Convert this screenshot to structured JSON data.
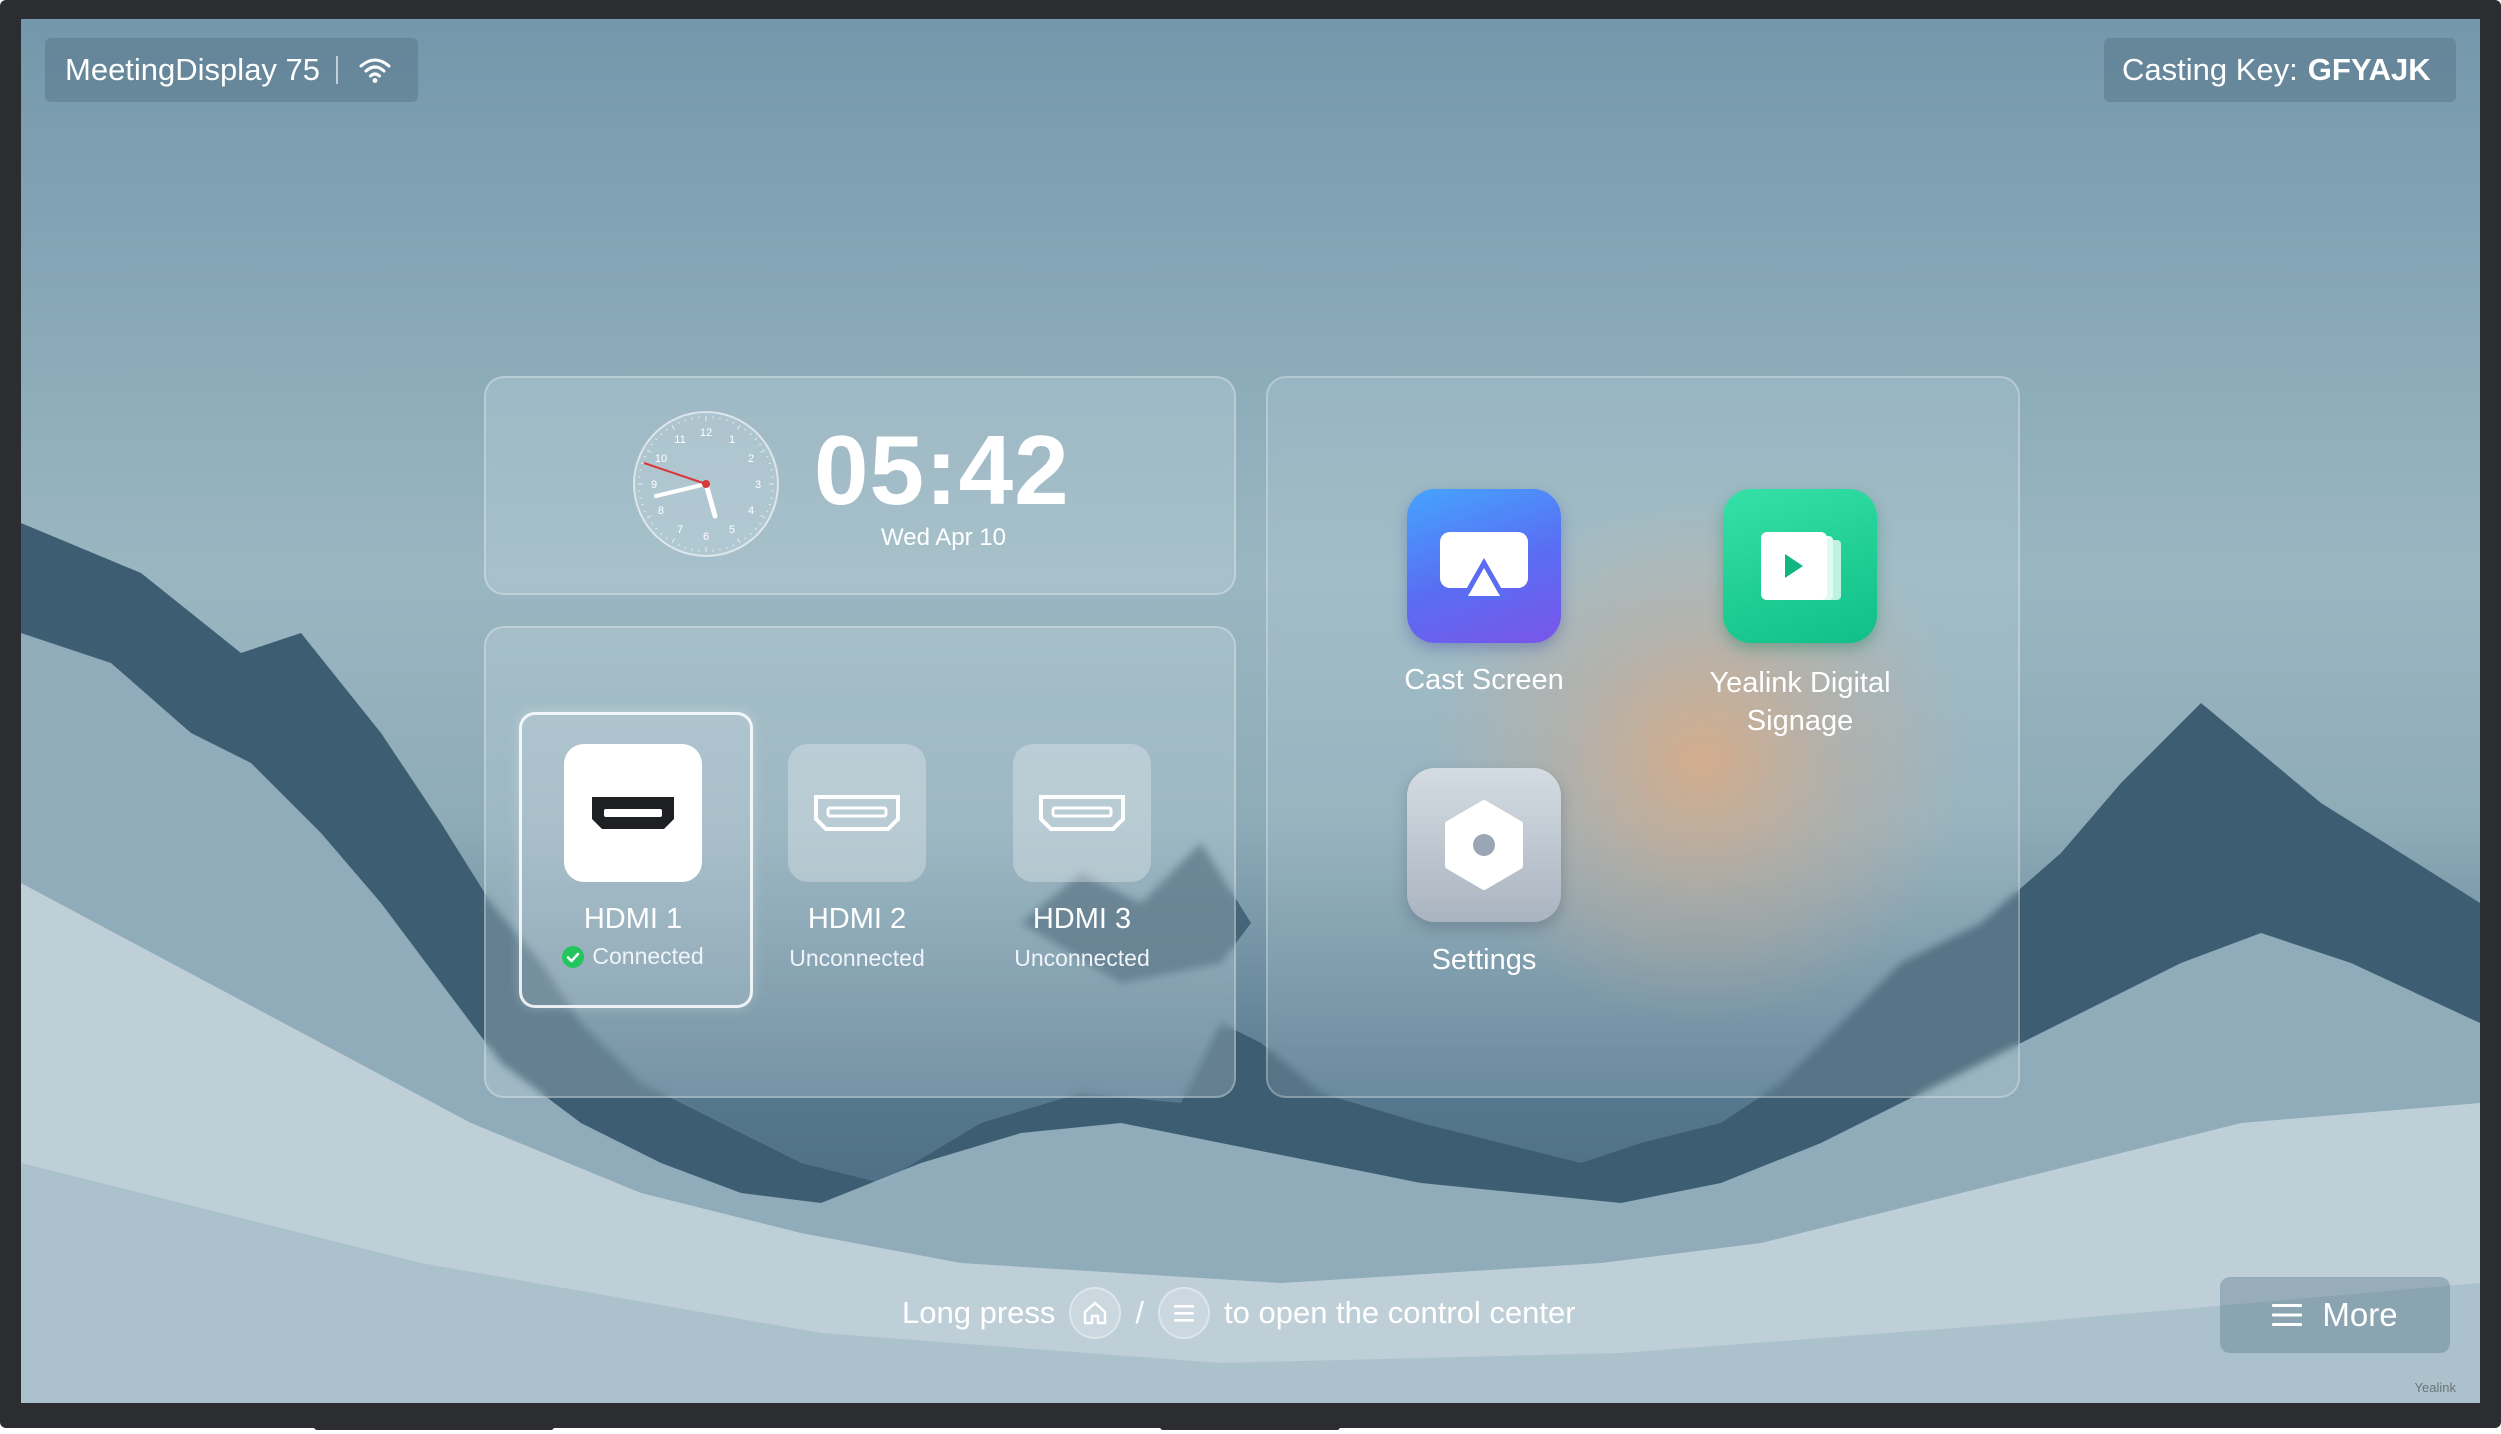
{
  "status_bar": {
    "device_name": "MeetingDisplay 75",
    "casting_key_label": "Casting Key:",
    "casting_key_value": "GFYAJK"
  },
  "clock": {
    "time": "05:42",
    "date": "Wed Apr 10",
    "dial_numbers": [
      "12",
      "1",
      "2",
      "3",
      "4",
      "5",
      "6",
      "7",
      "8",
      "9",
      "10",
      "11"
    ]
  },
  "sources": [
    {
      "name": "HDMI 1",
      "status": "Connected",
      "selected": true
    },
    {
      "name": "HDMI 2",
      "status": "Unconnected",
      "selected": false
    },
    {
      "name": "HDMI 3",
      "status": "Unconnected",
      "selected": false
    }
  ],
  "apps": {
    "cast_screen": "Cast Screen",
    "digital_signage_line1": "Yealink Digital",
    "digital_signage_line2": "Signage",
    "settings": "Settings"
  },
  "footer": {
    "hint_prefix": "Long press",
    "hint_separator": "/",
    "hint_suffix": "to open the control center",
    "more_label": "More",
    "brand": "Yealink"
  },
  "colors": {
    "connected_green": "#22c55e",
    "cast_blue": "#4f6cf5",
    "signage_green": "#12c98e",
    "settings_gray": "#b9c2cc"
  }
}
